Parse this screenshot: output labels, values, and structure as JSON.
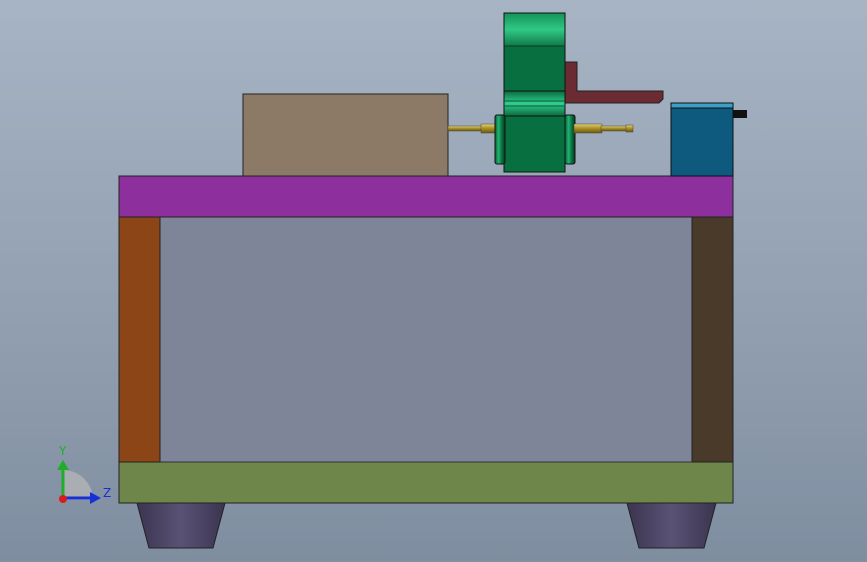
{
  "viewport": {
    "background": "#95a3b5"
  },
  "triad": {
    "y_label": "Y",
    "z_label": "Z",
    "colors": {
      "y": "#1fae2a",
      "z": "#1530d6",
      "x": "#d81c1c",
      "arc": "#b9b9b9"
    }
  },
  "parts": {
    "table_top": "#8d2f9d",
    "left_leg": "#8b4517",
    "right_leg": "#4a3a2a",
    "panel": "#7f8598",
    "base": "#6f864a",
    "feet": "#4a4460",
    "gearbox": "#8c7a66",
    "motor_housing": "#087040",
    "motor_band": "#1ca36a",
    "bracket": "#6a2b33",
    "control_box": "#0d5a7e",
    "control_box_top": "#3aa0c8",
    "shaft": "#b9a13a",
    "plug": "#111111"
  }
}
